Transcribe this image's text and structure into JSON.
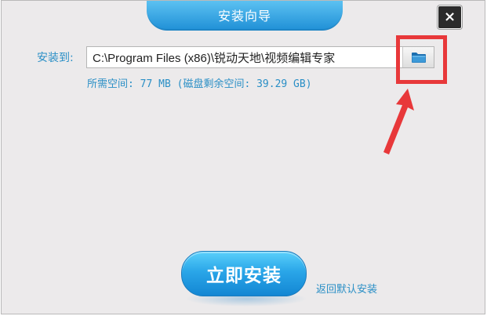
{
  "window": {
    "title": "安装向导",
    "close_label": "×"
  },
  "install": {
    "label": "安装到:",
    "path_value": "C:\\Program Files (x86)\\锐动天地\\视频编辑专家",
    "space_info": "所需空间: 77 MB (磁盘剩余空间: 39.29 GB)"
  },
  "actions": {
    "install_now_label": "立即安装",
    "back_default_label": "返回默认安装"
  },
  "colors": {
    "accent_blue": "#2a8fc6",
    "title_blue": "#1f8fd6",
    "highlight_red": "#e8383a"
  }
}
